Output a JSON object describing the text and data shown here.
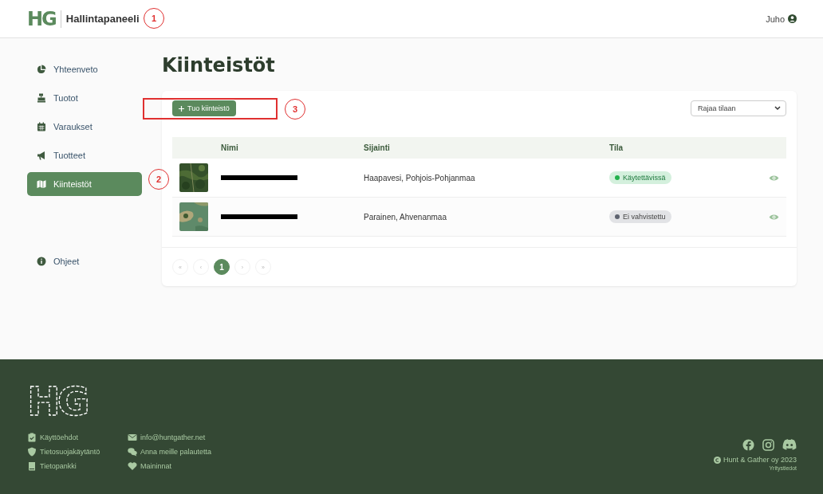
{
  "header": {
    "logo": "HG",
    "title": "Hallintapaneeli",
    "user": "Juho"
  },
  "sidebar": {
    "items": [
      {
        "label": "Yhteenveto",
        "selected": false
      },
      {
        "label": "Tuotot",
        "selected": false
      },
      {
        "label": "Varaukset",
        "selected": false
      },
      {
        "label": "Tuotteet",
        "selected": false
      },
      {
        "label": "Kiinteistöt",
        "selected": true
      }
    ],
    "help": {
      "label": "Ohjeet"
    }
  },
  "page": {
    "title": "Kiinteistöt",
    "add_button": "Tuo kiinteistö",
    "filter": {
      "placeholder": "Rajaa tilaan"
    }
  },
  "table": {
    "columns": [
      "Nimi",
      "Sijainti",
      "Tila"
    ],
    "rows": [
      {
        "location": "Haapavesi, Pohjois-Pohjanmaa",
        "status": {
          "label": "Käytettävissä",
          "kind": "available"
        }
      },
      {
        "location": "Parainen, Ahvenanmaa",
        "status": {
          "label": "Ei vahvistettu",
          "kind": "unverified"
        }
      }
    ]
  },
  "pagination": [
    {
      "label": "«",
      "selected": false
    },
    {
      "label": "‹",
      "selected": false
    },
    {
      "label": "1",
      "selected": true
    },
    {
      "label": "›",
      "selected": false
    },
    {
      "label": "»",
      "selected": false
    }
  ],
  "footer": {
    "logo": "HG",
    "links_1": [
      {
        "label": "Käyttöehdot"
      },
      {
        "label": "Tietosuojakäytäntö"
      },
      {
        "label": "Tietopankki"
      }
    ],
    "links_2": [
      {
        "label": "info@huntgather.net"
      },
      {
        "label": "Anna meille palautetta"
      },
      {
        "label": "Maininnat"
      }
    ],
    "copyright": "Hunt & Gather oy 2023",
    "company_info": "Yritystiedot"
  },
  "annotations": [
    {
      "label": "1",
      "kind": "circle"
    },
    {
      "label": "2",
      "kind": "circle"
    },
    {
      "label": "3",
      "kind": "circle"
    },
    {
      "kind": "rectangle"
    }
  ]
}
